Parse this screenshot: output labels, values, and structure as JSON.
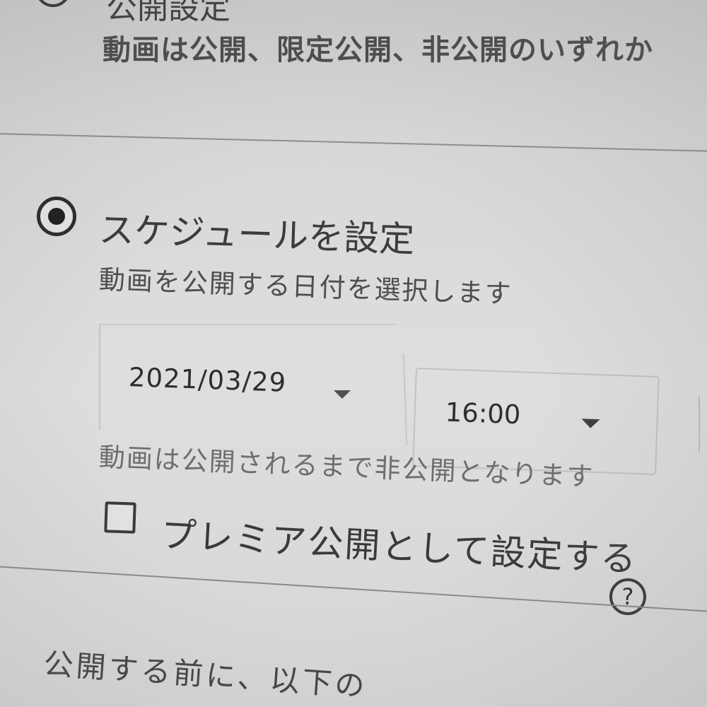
{
  "visibility_section": {
    "title": "公開設定",
    "description": "動画は公開、限定公開、非公開のいずれか"
  },
  "schedule": {
    "option_label": "スケジュールを設定",
    "description": "動画を公開する日付を選択します",
    "selected": true,
    "date_value": "2021/03/29",
    "time_value": "16:00",
    "private_until_note": "動画は公開されるまで非公開となります",
    "premiere_label": "プレミア公開として設定する",
    "premiere_checked": false,
    "help_icon_glyph": "?"
  },
  "footer": {
    "line1": "公開する前に、以下の",
    "line2": ""
  }
}
